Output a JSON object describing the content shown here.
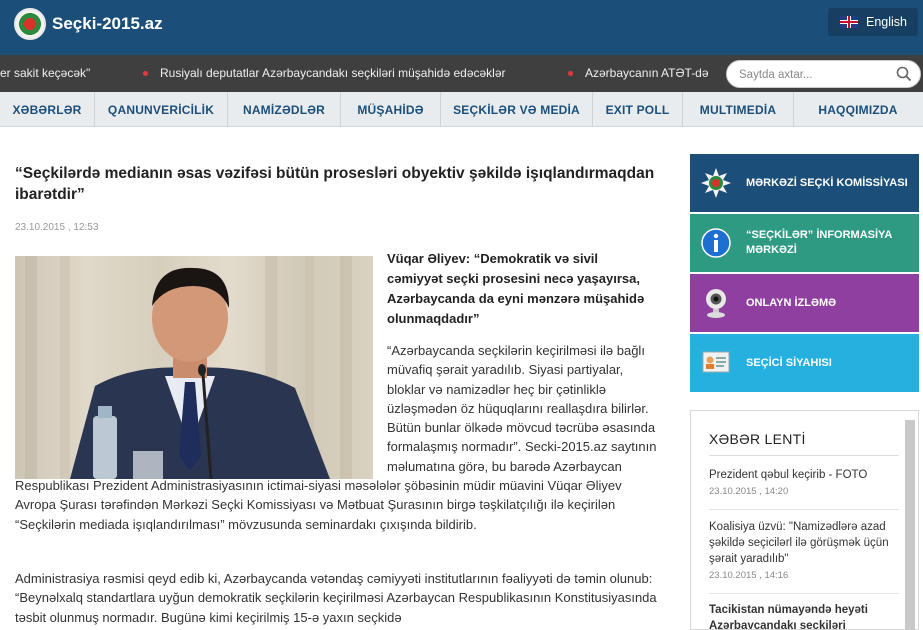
{
  "header": {
    "site_name": "Seçki-2015.az",
    "language_label": "English"
  },
  "ticker": {
    "items": [
      "er sakit keçəcək\"",
      "Rusiyalı deputatlar Azərbaycandakı seçkiləri müşahidə edəcəklər",
      "Azərbaycanın ATƏT-dəki"
    ]
  },
  "search": {
    "placeholder": "Saytda axtar..."
  },
  "nav": {
    "items": [
      "XƏBƏRLƏR",
      "QANUNVERİCİLİK",
      "NAMİZƏDLƏR",
      "MÜŞAHİDƏ",
      "SEÇKİLƏR VƏ MEDİA",
      "EXIT POLL",
      "MULTIMEDİA",
      "HAQQIMIZDA"
    ]
  },
  "article": {
    "title": "“Seçkilərdə medianın əsas vəzifəsi bütün prosesləri obyektiv şəkildə işıqlandırmaqdan ibarətdir”",
    "date": "23.10.2015 , 12:53",
    "lead": "Vüqar Əliyev: “Demokratik və sivil cəmiyyət seçki prosesini necə yaşayırsa, Azərbaycanda da eyni mənzərə müşahidə olunmaqdadır”",
    "body_wrap": "“Azərbaycanda seçkilərin keçirilməsi ilə bağlı müvafiq şərait yaradılıb. Siyasi partiyalar, bloklar və namizədlər heç bir çətinliklə üzləşmədən öz hüquqlarını reallaşdıra bilirlər. Bütün bunlar ölkədə mövcud təcrübə əsasında formalaşmış normadır”. Secki-2015.az saytının məlumatına görə, bu barədə Azərbaycan",
    "body_full_1": "Respublikası Prezident Administrasiyasının ictimai-siyasi məsələlər şöbəsinin müdir müavini Vüqar Əliyev Avropa Şurası tərəfindən Mərkəzi Seçki Komissiyası və Mətbuat Şurasının birgə təşkilatçılığı ilə keçirilən “Seçkilərin mediada işıqlandırılması” mövzusunda seminardakı çıxışında bildirib.",
    "body_full_2": "Administrasiya rəsmisi qeyd edib ki, Azərbaycanda vətəndaş cəmiyyəti institutlarının fəaliyyəti də təmin olunub: “Beynəlxalq standartlara uyğun demokratik seçkilərin keçirilməsi Azərbaycan Respublikasının Konstitusiyasında təsbit olunmuş normadır. Bugünə kimi keçirilmiş 15-ə yaxın seçkidə"
  },
  "sidebar": {
    "buttons": [
      {
        "label": "MƏRKƏZİ SEÇKİ KOMİSSİYASI",
        "color": "#1b4f79",
        "icon": "emblem-icon"
      },
      {
        "label": "“SEÇKİLƏR” İNFORMASİYA MƏRKƏZİ",
        "color": "#2e9a82",
        "icon": "info-icon"
      },
      {
        "label": "ONLAYN İZLƏMƏ",
        "color": "#8e3f9f",
        "icon": "webcam-icon"
      },
      {
        "label": "SEÇİCİ SİYAHISI",
        "color": "#25b0e0",
        "icon": "voter-list-icon"
      }
    ],
    "news": {
      "title": "XƏBƏR LENTİ",
      "items": [
        {
          "title": "Prezident qəbul keçirib - FOTO",
          "date": "23.10.2015 , 14:20"
        },
        {
          "title": "Koalisiya üzvü: \"Namizədlərə azad şəkildə seçicilərl ilə görüşmək üçün şərait yaradılıb\"",
          "date": "23.10.2015 , 14:16"
        },
        {
          "title": "Tacikistan nümayəndə heyəti Azərbaycandakı seçkiləri",
          "date": ""
        }
      ]
    }
  }
}
